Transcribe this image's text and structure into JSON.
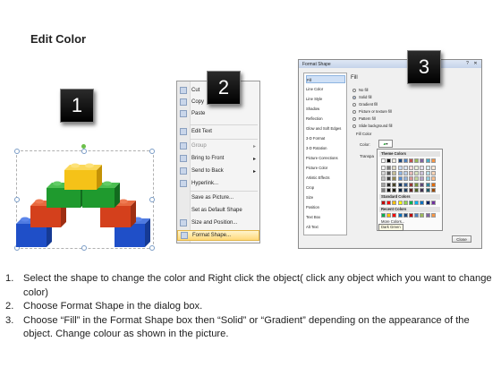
{
  "title": "Edit Color",
  "badges": [
    "1",
    "2",
    "3"
  ],
  "context_menu": {
    "items": [
      {
        "label": "Cut",
        "icon": "scissors-icon"
      },
      {
        "label": "Copy",
        "icon": "copy-icon"
      },
      {
        "label": "Paste",
        "icon": "paste-icon"
      },
      {
        "label": "Edit Text",
        "icon": "edit-text-icon"
      },
      {
        "label": "Group",
        "icon": "group-icon",
        "submenu": true
      },
      {
        "label": "Bring to Front",
        "icon": "bring-front-icon",
        "submenu": true
      },
      {
        "label": "Send to Back",
        "icon": "send-back-icon",
        "submenu": true
      },
      {
        "label": "Hyperlink...",
        "icon": "hyperlink-icon"
      },
      {
        "label": "Save as Picture...",
        "icon": ""
      },
      {
        "label": "Set as Default Shape",
        "icon": ""
      },
      {
        "label": "Size and Position...",
        "icon": "size-icon"
      },
      {
        "label": "Format Shape...",
        "icon": "format-shape-icon",
        "highlighted": true
      }
    ]
  },
  "dialog": {
    "title": "Format Shape",
    "categories": [
      "Fill",
      "Line Color",
      "Line Style",
      "Shadow",
      "Reflection",
      "Glow and Soft Edges",
      "3-D Format",
      "3-D Rotation",
      "Picture Corrections",
      "Picture Color",
      "Artistic Effects",
      "Crop",
      "Size",
      "Position",
      "Text Box",
      "Alt Text"
    ],
    "pane_heading": "Fill",
    "fill_options": [
      "No fill",
      "Solid fill",
      "Gradient fill",
      "Picture or texture fill",
      "Pattern fill",
      "Slide background fill"
    ],
    "selected_fill": "Solid fill",
    "fill_color_label": "Fill Color",
    "color_label": "Color:",
    "transparency_label": "Transpa",
    "palette": {
      "theme_label": "Theme Colors",
      "standard_label": "Standard Colors",
      "recent_label": "Recent Colors",
      "more_label": "More Colors...",
      "theme_top": [
        "#ffffff",
        "#000000",
        "#eeece1",
        "#1f497d",
        "#4f81bd",
        "#c0504d",
        "#9bbb59",
        "#8064a2",
        "#4bacc6",
        "#f79646"
      ],
      "theme_shades": [
        [
          "#f2f2f2",
          "#7f7f7f",
          "#ddd9c3",
          "#c6d9f0",
          "#dbe5f1",
          "#f2dcdb",
          "#ebf1dd",
          "#e5e0ec",
          "#dbeef3",
          "#fdeada"
        ],
        [
          "#d8d8d8",
          "#595959",
          "#c4bd97",
          "#8db3e2",
          "#b8cce4",
          "#e5b9b7",
          "#d7e3bc",
          "#ccc1d9",
          "#b7dde8",
          "#fbd5b5"
        ],
        [
          "#bfbfbf",
          "#3f3f3f",
          "#938953",
          "#548dd4",
          "#95b3d7",
          "#d99694",
          "#c3d69b",
          "#b2a2c7",
          "#92cddc",
          "#fac08f"
        ],
        [
          "#a5a5a5",
          "#262626",
          "#494429",
          "#17365d",
          "#366092",
          "#953734",
          "#76923c",
          "#5f497a",
          "#31859b",
          "#e36c09"
        ],
        [
          "#7f7f7f",
          "#0c0c0c",
          "#1d1b10",
          "#0f243e",
          "#244061",
          "#632423",
          "#4f6128",
          "#3f3151",
          "#205867",
          "#974806"
        ]
      ],
      "standard": [
        "#c00000",
        "#ff0000",
        "#ffc000",
        "#ffff00",
        "#92d050",
        "#00b050",
        "#00b0f0",
        "#0070c0",
        "#002060",
        "#7030a0"
      ],
      "recent": [
        "#00b050",
        "#ffc000",
        "#ff0000",
        "#0070c0",
        "#1f497d",
        "#c00000",
        "#4f81bd",
        "#9bbb59",
        "#8064a2",
        "#f79646"
      ]
    },
    "tooltip": "Dark Green",
    "close_label": "Close",
    "colors": {
      "selected_category": "#cfe0f6",
      "title_bar": "#c4d3ea"
    }
  },
  "instructions": [
    {
      "num": "1.",
      "text": "Select the shape to change the color and Right click the object( click any object which you want to change color)"
    },
    {
      "num": "2.",
      "text": "Choose Format Shape in the dialog box."
    },
    {
      "num": "3.",
      "text": "Choose “Fill” in the Format Shape box then “Solid” or “Gradient” depending on the appearance of the object. Change colour as shown in the picture."
    }
  ],
  "block_colors": {
    "yellow": "#f5c218",
    "green": "#1f9a2e",
    "red": "#d4401c",
    "blue": "#1f4fc8"
  }
}
